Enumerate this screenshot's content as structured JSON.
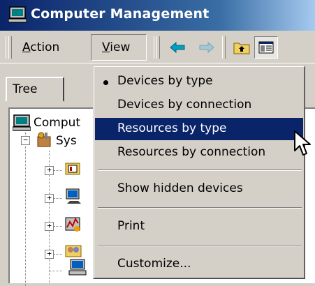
{
  "window": {
    "title": "Computer Management"
  },
  "toolbar": {
    "menus": [
      {
        "label": "Action",
        "underline": "A",
        "rest": "ction"
      },
      {
        "label": "View",
        "underline": "V",
        "rest": "iew"
      }
    ],
    "icons": [
      "back-arrow-icon",
      "forward-arrow-icon",
      "up-folder-icon",
      "show-hide-tree-icon"
    ]
  },
  "tabs": [
    {
      "label": "Tree"
    }
  ],
  "tree": {
    "root": {
      "label": "Comput"
    },
    "child": {
      "label": "Sys"
    }
  },
  "view_menu": {
    "items": [
      {
        "label": "Devices by type",
        "checked": true,
        "highlighted": false
      },
      {
        "label": "Devices by connection",
        "checked": false,
        "highlighted": false
      },
      {
        "label": "Resources by type",
        "checked": false,
        "highlighted": true
      },
      {
        "label": "Resources by connection",
        "checked": false,
        "highlighted": false
      },
      {
        "label": "Show hidden devices",
        "checked": false,
        "highlighted": false
      },
      {
        "label": "Print",
        "checked": false,
        "highlighted": false
      },
      {
        "label": "Customize...",
        "checked": false,
        "highlighted": false
      }
    ]
  },
  "colors": {
    "highlight": "#0a246a",
    "face": "#d4d0c8"
  }
}
